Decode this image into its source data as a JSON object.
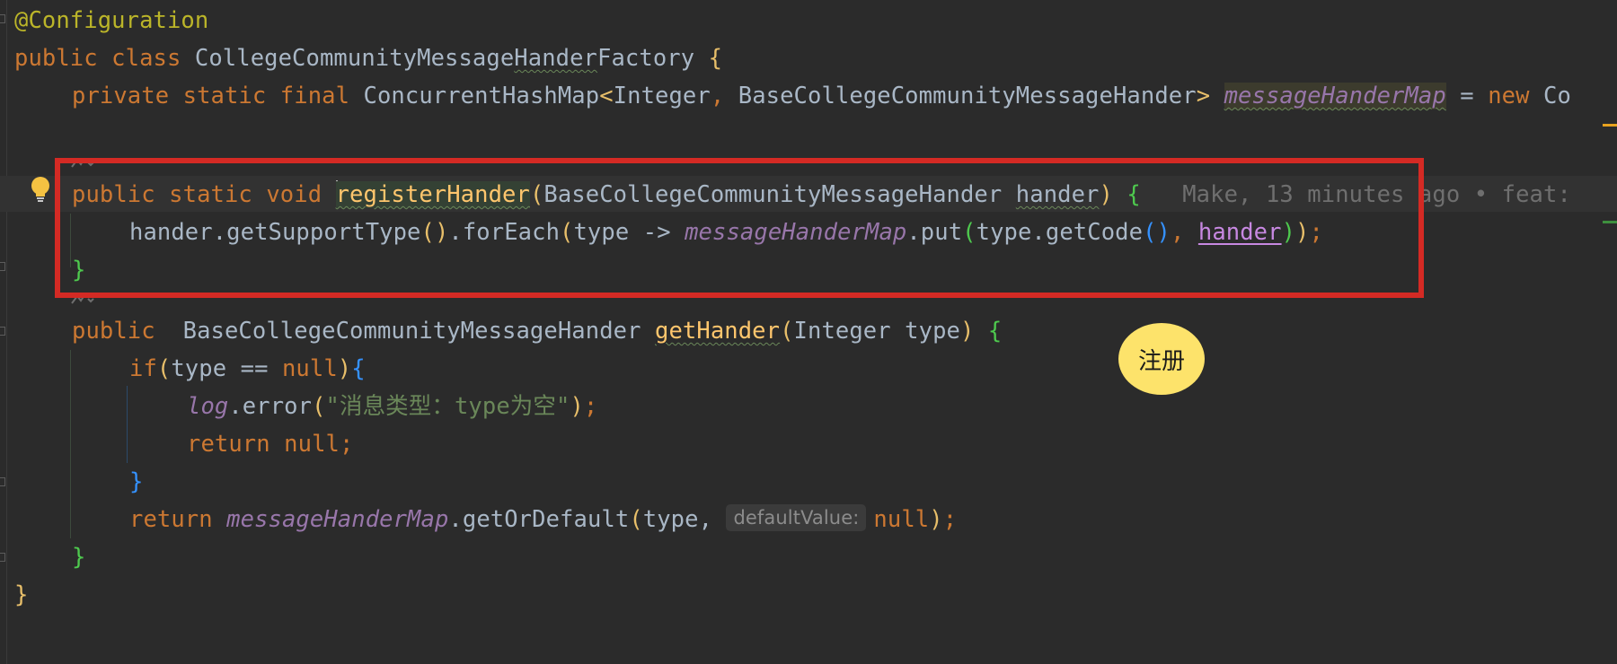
{
  "editor": {
    "language": "Java",
    "lines": {
      "l1": {
        "annotation": "@Configuration"
      },
      "l2": {
        "kw1": "public",
        "kw2": "class",
        "class_name_a": "CollegeCommunityMessage",
        "class_name_typo": "Hander",
        "class_name_b": "Factory",
        "brace": "{"
      },
      "l3": {
        "kw1": "private",
        "kw2": "static",
        "kw3": "final",
        "type1": "ConcurrentHashMap",
        "lt": "<",
        "type2": "Integer",
        "comma": ",",
        "type3": "BaseCollegeCommunityMessageHander",
        "gt": ">",
        "field": "messageHanderMap",
        "eq": "=",
        "kw_new": "new",
        "tail": "Co"
      },
      "l5": {
        "kw1": "public",
        "kw2": "static",
        "kw3": "void",
        "method": "registerHander",
        "open": "(",
        "param_type": "BaseCollegeCommunityMessageHander",
        "param_name": "hander",
        "close": ")",
        "brace": "{",
        "blame": "Make, 13 minutes ago • feat:"
      },
      "l6": {
        "t1": "hander.getSupportType",
        "p1": "()",
        "t2": ".forEach",
        "p2": "(",
        "t3": "type -> ",
        "field": "messageHanderMap",
        "t4": ".put",
        "p3": "(",
        "t5": "type.getCode",
        "p4": "()",
        "t6": ", ",
        "param": "hander",
        "p5": ")",
        "p6": ")",
        "semi": ";"
      },
      "l7": {
        "brace": "}"
      },
      "l8": {
        "kw1": "public",
        "type": "BaseCollegeCommunityMessageHander",
        "method": "getHander",
        "open": "(",
        "params": "Integer type",
        "close": ")",
        "brace": "{"
      },
      "l9": {
        "kw_if": "if",
        "open": "(",
        "cond": "type == ",
        "kw_null": "null",
        "close": ")",
        "brace": "{"
      },
      "l10": {
        "field": "log",
        "call": ".error",
        "open": "(",
        "string": "\"消息类型：type为空\"",
        "close": ")",
        "semi": ";"
      },
      "l11": {
        "kw_return": "return",
        "kw_null": "null",
        "semi": ";"
      },
      "l12": {
        "brace": "}"
      },
      "l13": {
        "kw_return": "return",
        "field": "messageHanderMap",
        "call": ".getOrDefault",
        "open": "(",
        "arg": "type, ",
        "hint": "defaultValue:",
        "kw_null": "null",
        "close": ")",
        "semi": ";"
      },
      "l14": {
        "brace": "}"
      },
      "l15": {
        "brace": "}"
      }
    }
  },
  "overlay": {
    "tooltip_label": "注册",
    "highlight_color": "#d42a24",
    "tooltip_color": "#fde36b"
  },
  "colors": {
    "background": "#2b2b2b",
    "keyword": "#cc7832",
    "annotation": "#bbb529",
    "method": "#ffc66d",
    "field": "#9876aa",
    "string": "#6a8759",
    "text": "#a9b7c6"
  }
}
